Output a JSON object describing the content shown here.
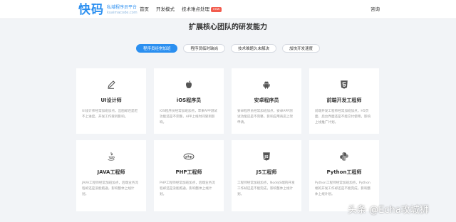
{
  "header": {
    "logo_main": "快码",
    "logo_sub_line1": "私域程序员平台",
    "logo_sub_line2": "kuaimacode.com",
    "nav": [
      "首页",
      "开发模式",
      "技术难点处理"
    ],
    "badge": "new",
    "consult": "咨询",
    "accent_color": "#2b8ff0"
  },
  "section": {
    "title": "扩展核心团队的研发能力"
  },
  "tabs": [
    {
      "label": "程序员经常加班",
      "active": true
    },
    {
      "label": "程序员临时缺岗",
      "active": false
    },
    {
      "label": "技术难题久未解决",
      "active": false
    },
    {
      "label": "加快开发速度",
      "active": false
    }
  ],
  "cards": [
    {
      "icon": "edit-pen-icon",
      "title": "UI设计师",
      "desc": "UI设计师经常加班加点，出图却还是赶不上进度，开发工作受到影响。"
    },
    {
      "icon": "apple-icon",
      "title": "iOS程序员",
      "desc": "iOS程序员经常加班加点，苹果APP测试功能还是不完整，APP上线时间受到影响。"
    },
    {
      "icon": "android-icon",
      "title": "安卓程序员",
      "desc": "安卓程序员经常加班加点，安卓APP测试功能还是不完整，影响应用商店上架申请。"
    },
    {
      "icon": "html5-icon",
      "title": "前端开发工程师",
      "desc": "前端开发工程师经常加班加点，H5页面、后台界面还是不能交付使用，影响上线推广计划。"
    },
    {
      "icon": "java-icon",
      "title": "JAVA工程师",
      "desc": "JAVA工程师经常加班加点，后端业务流程却还是没能跑通，影响整体上线计划。"
    },
    {
      "icon": "php-icon",
      "title": "PHP工程师",
      "desc": "PHP工程师经常加班加点，后端业务流程却还是没能跑通，影响整体上线计划。"
    },
    {
      "icon": "javascript-icon",
      "title": "JS工程师",
      "desc": "工程师经常加班加点，NodeJS端的开发工作却还是不能完成，影响整体上线计划。"
    },
    {
      "icon": "python-icon",
      "title": "Python工程师",
      "desc": "Python工程师经常加班加点，Python端的开发工作却还是不能完成，影响整体上线计划。"
    }
  ],
  "watermark": "头条 @Echa攻城狮"
}
